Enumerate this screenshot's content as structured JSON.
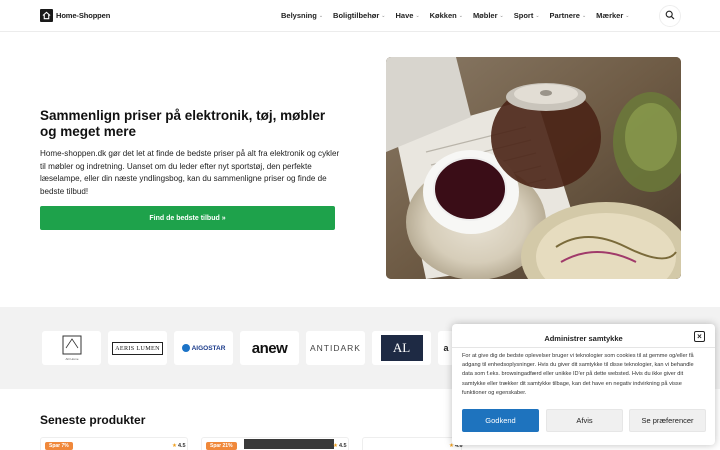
{
  "header": {
    "logo_text": "Home-Shoppen",
    "nav": [
      {
        "label": "Belysning"
      },
      {
        "label": "Boligtilbehør"
      },
      {
        "label": "Have"
      },
      {
        "label": "Køkken"
      },
      {
        "label": "Møbler"
      },
      {
        "label": "Sport"
      },
      {
        "label": "Partnere"
      },
      {
        "label": "Mærker"
      }
    ],
    "search_icon": "search-icon"
  },
  "hero": {
    "title": "Sammenlign priser på elektronik, tøj, møbler og meget mere",
    "text": "Home-shoppen.dk gør det let at finde de bedste priser på alt fra elektronik og cykler til møbler og indretning. Uanset om du leder efter nyt sportstøj, den perfekte læselampe, eller din næste yndlingsbog, kan du sammenligne priser og finde de bedste tilbud!",
    "cta": "Find de bedste tilbud »"
  },
  "brands": [
    {
      "name": "AD Home"
    },
    {
      "name": "AERIS LUMEN"
    },
    {
      "name": "AIGOSTAR"
    },
    {
      "name": "anew"
    },
    {
      "name": "ANTIDARK"
    },
    {
      "name": "AL"
    }
  ],
  "latest": {
    "title": "Seneste produkter",
    "cards": [
      {
        "badge": "Spar 7%",
        "rating": "4.5"
      },
      {
        "badge": "Spar 21%",
        "rating": "4.5"
      },
      {
        "badge": "",
        "rating": "4.6"
      }
    ]
  },
  "consent": {
    "title": "Administrer samtykke",
    "text": "For at give dig de bedste oplevelser bruger vi teknologier som cookies til at gemme og/eller få adgang til enhedsoplysninger. Hvis du giver dit samtykke til disse teknologier, kan vi behandle data som f.eks. browsingadfærd eller unikke ID'er på dette websted. Hvis du ikke giver dit samtykke eller trækker dit samtykke tilbage, kan det have en negativ indvirkning på visse funktioner og egenskaber.",
    "accept": "Godkend",
    "deny": "Afvis",
    "prefs": "Se præferencer"
  },
  "colors": {
    "cta": "#1ea24b",
    "accept": "#1e73be",
    "badge": "#f0883a",
    "brand_band": "#f2f2f2"
  }
}
